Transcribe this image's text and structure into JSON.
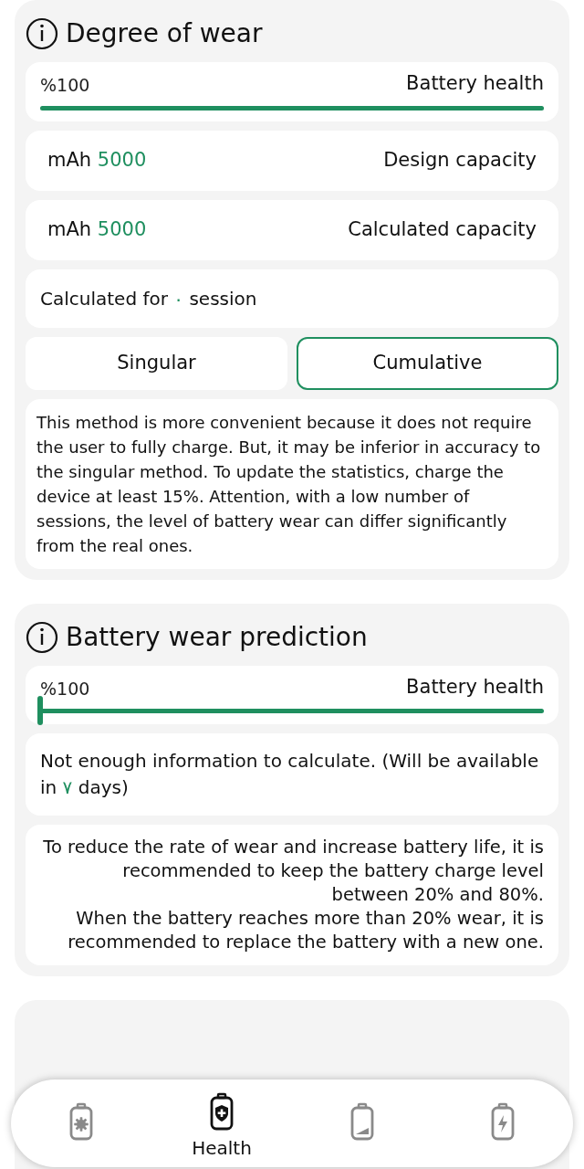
{
  "wear": {
    "title": "Degree of wear",
    "health": {
      "value": "%100",
      "label": "Battery health",
      "level": 1
    },
    "design": {
      "unit": "mAh",
      "value": "5000",
      "label": "Design capacity"
    },
    "calculated": {
      "unit": "mAh",
      "value": "5000",
      "label": "Calculated capacity"
    },
    "sessions": {
      "prefix": "Calculated for",
      "count": "۰",
      "suffix": "session"
    },
    "tabs": [
      {
        "label": "Singular",
        "selected": false
      },
      {
        "label": "Cumulative",
        "selected": true
      }
    ],
    "description": "This method is more convenient because it does not require the user to fully charge. But, it may be inferior in accuracy to the singular method. To update the statistics, charge the device at least 15%. Attention, with a low number of sessions, the level of battery wear can differ significantly from the real ones."
  },
  "prediction": {
    "title": "Battery wear prediction",
    "health": {
      "value": "%100",
      "label": "Battery health",
      "level": 0
    },
    "notice": {
      "prefix": "Not enough information to calculate. (Will be available in",
      "count": "۷",
      "suffix": "days)"
    },
    "advice": [
      "To reduce the rate of wear and increase battery life, it is recommended to keep the battery charge level between 20% and 80%.",
      "When the battery reaches more than 20% wear, it is recommended to replace the battery with a new one."
    ]
  },
  "nav": [
    {
      "kind": "gear",
      "selected": false
    },
    {
      "kind": "health",
      "label": "Health",
      "selected": true
    },
    {
      "kind": "level",
      "selected": false
    },
    {
      "kind": "charge",
      "selected": false
    }
  ]
}
